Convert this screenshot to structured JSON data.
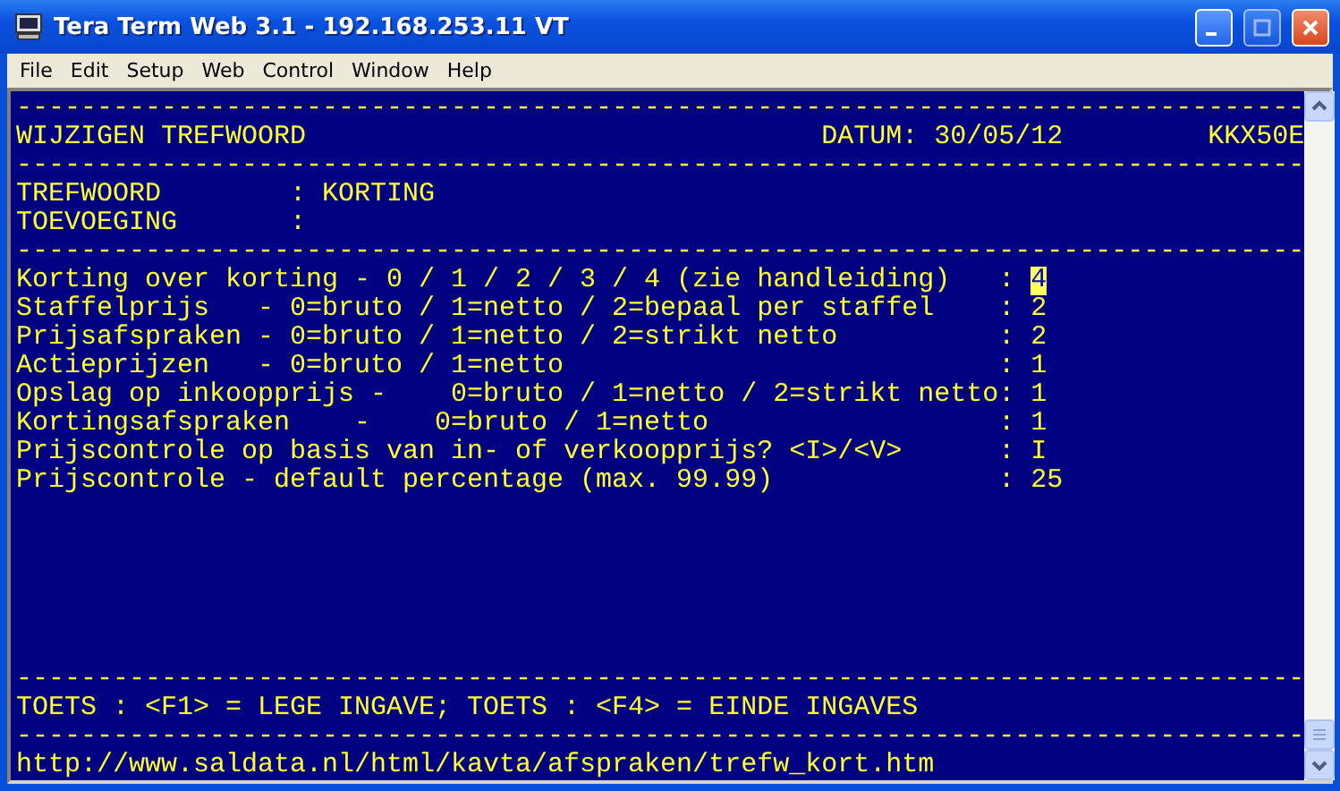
{
  "window": {
    "title": "Tera Term Web 3.1 - 192.168.253.11 VT"
  },
  "menu": [
    "File",
    "Edit",
    "Setup",
    "Web",
    "Control",
    "Window",
    "Help"
  ],
  "terminal": {
    "rule": "--------------------------------------------------------------------------------",
    "header": {
      "title": "WIJZIGEN TREFWOORD",
      "date": "DATUM: 30/05/12",
      "code": "KKX50E"
    },
    "keyword_fields": [
      {
        "label": "TREFWOORD",
        "separator": ":",
        "value": "KORTING"
      },
      {
        "label": "TOEVOEGING",
        "separator": ":"
      }
    ],
    "settings": [
      {
        "label": "Korting over korting - 0 / 1 / 2 / 3 / 4 (zie handleiding)",
        "separator": ":",
        "value": "4",
        "cursor": true
      },
      {
        "label": "Staffelprijs   - 0=bruto / 1=netto / 2=bepaal per staffel",
        "separator": ":",
        "value": "2",
        "cursor": false
      },
      {
        "label": "Prijsafspraken - 0=bruto / 1=netto / 2=strikt netto",
        "separator": ":",
        "value": "2",
        "cursor": false
      },
      {
        "label": "Actieprijzen   - 0=bruto / 1=netto",
        "separator": ":",
        "value": "1",
        "cursor": false
      },
      {
        "label": "Opslag op inkoopprijs -    0=bruto / 1=netto / 2=strikt netto",
        "separator": ":",
        "value": "1",
        "cursor": false
      },
      {
        "label": "Kortingsafspraken    -    0=bruto / 1=netto",
        "separator": ":",
        "value": "1",
        "cursor": false
      },
      {
        "label": "Prijscontrole op basis van in- of verkoopprijs? <I>/<V>",
        "separator": ":",
        "value": "I",
        "cursor": false
      },
      {
        "label": "Prijscontrole - default percentage (max. 99.99)",
        "separator": ":",
        "value": "25",
        "cursor": false
      }
    ],
    "footer": "TOETS : <F1> = LEGE INGAVE; TOETS : <F4> = EINDE INGAVES",
    "url": "http://www.saldata.nl/html/kavta/afspraken/trefw_kort.htm"
  }
}
